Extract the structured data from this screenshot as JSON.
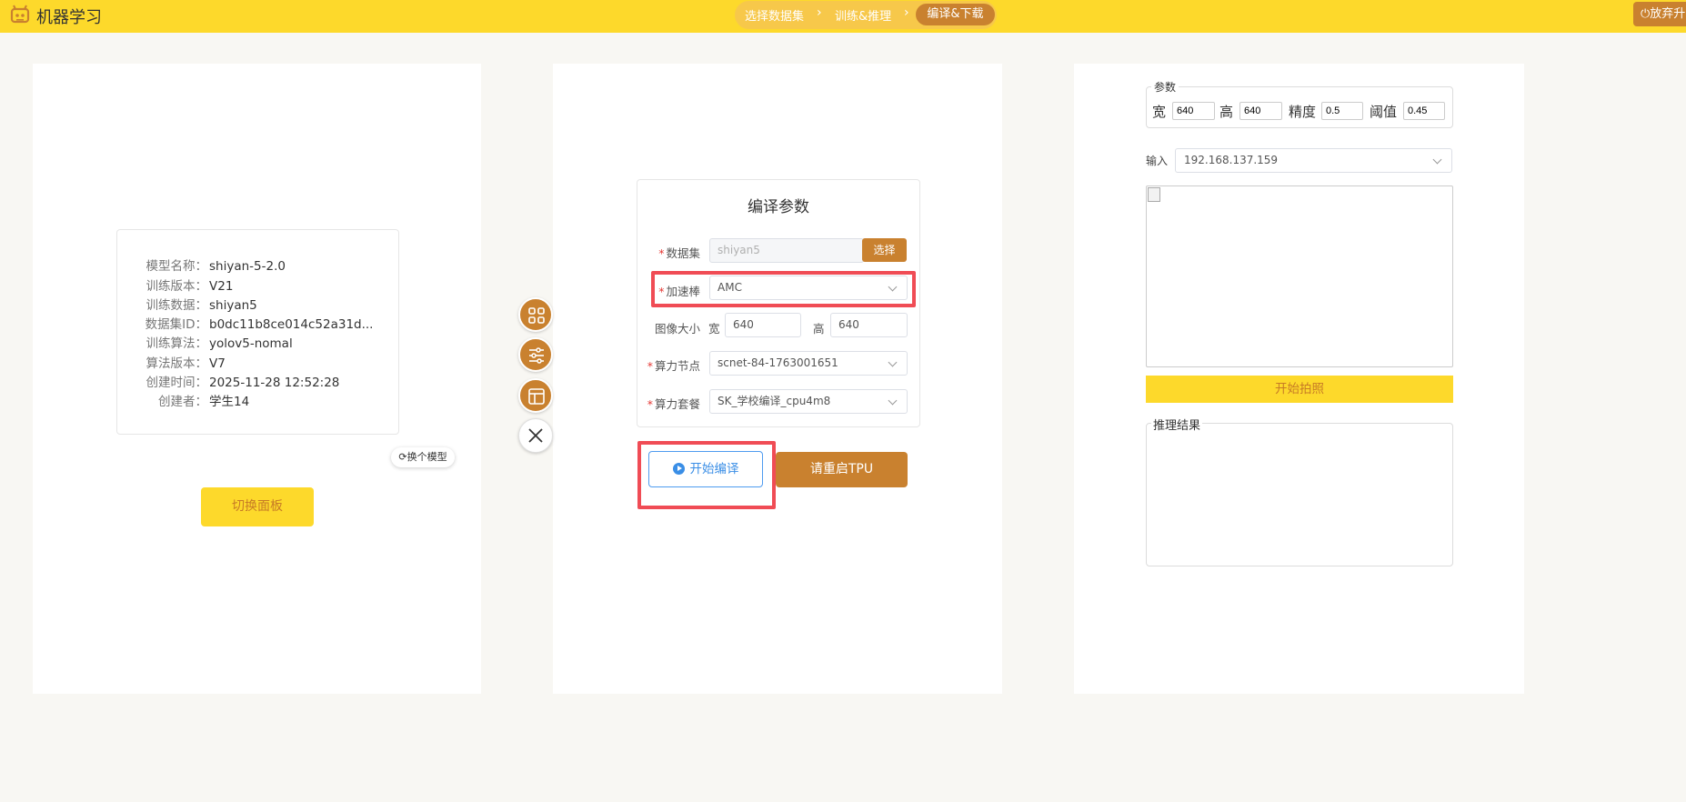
{
  "header": {
    "app_title": "机器学习",
    "steps": [
      {
        "label": "选择数据集"
      },
      {
        "label": "训练&推理"
      },
      {
        "label": "编译&下载"
      }
    ],
    "quit_label": "放弃升"
  },
  "model_info": {
    "rows": [
      {
        "label": "模型名称：",
        "value": "shiyan-5-2.0"
      },
      {
        "label": "训练版本：",
        "value": "V21"
      },
      {
        "label": "训练数据：",
        "value": "shiyan5"
      },
      {
        "label": "数据集ID：",
        "value": "b0dc11b8ce014c52a31d..."
      },
      {
        "label": "训练算法：",
        "value": "yolov5-nomal"
      },
      {
        "label": "算法版本：",
        "value": "V7"
      },
      {
        "label": "创建时间：",
        "value": "2025-11-28 12:52:28"
      },
      {
        "label": "创建者：",
        "value": "学生14"
      }
    ],
    "switch_model_label": "换个模型",
    "switch_panel_label": "切换面板"
  },
  "compile_form": {
    "title": "编译参数",
    "dataset": {
      "label": "数据集",
      "placeholder": "shiyan5",
      "button": "选择"
    },
    "accelerator": {
      "label": "加速棒",
      "value": "AMC"
    },
    "image_size": {
      "label": "图像大小",
      "width_label": "宽",
      "width": "640",
      "height_label": "高",
      "height": "640"
    },
    "compute_node": {
      "label": "算力节点",
      "value": "scnet-84-1763001651"
    },
    "compute_package": {
      "label": "算力套餐",
      "value": "SK_学校编译_cpu4m8"
    },
    "start_compile_label": "开始编译",
    "restart_tpu_label": "请重启TPU"
  },
  "inference": {
    "params_legend": "参数",
    "params": [
      {
        "label": "宽",
        "value": "640"
      },
      {
        "label": "高",
        "value": "640"
      },
      {
        "label": "精度",
        "value": "0.5"
      },
      {
        "label": "阈值",
        "value": "0.45"
      }
    ],
    "input_label": "输入",
    "input_value": "192.168.137.159",
    "shoot_label": "开始拍照",
    "result_label": "推理结果"
  },
  "colors": {
    "header_bg": "#fdd92b",
    "accent": "#c9812f",
    "highlight": "#f04c55",
    "primary_blue": "#3a8ee6"
  }
}
